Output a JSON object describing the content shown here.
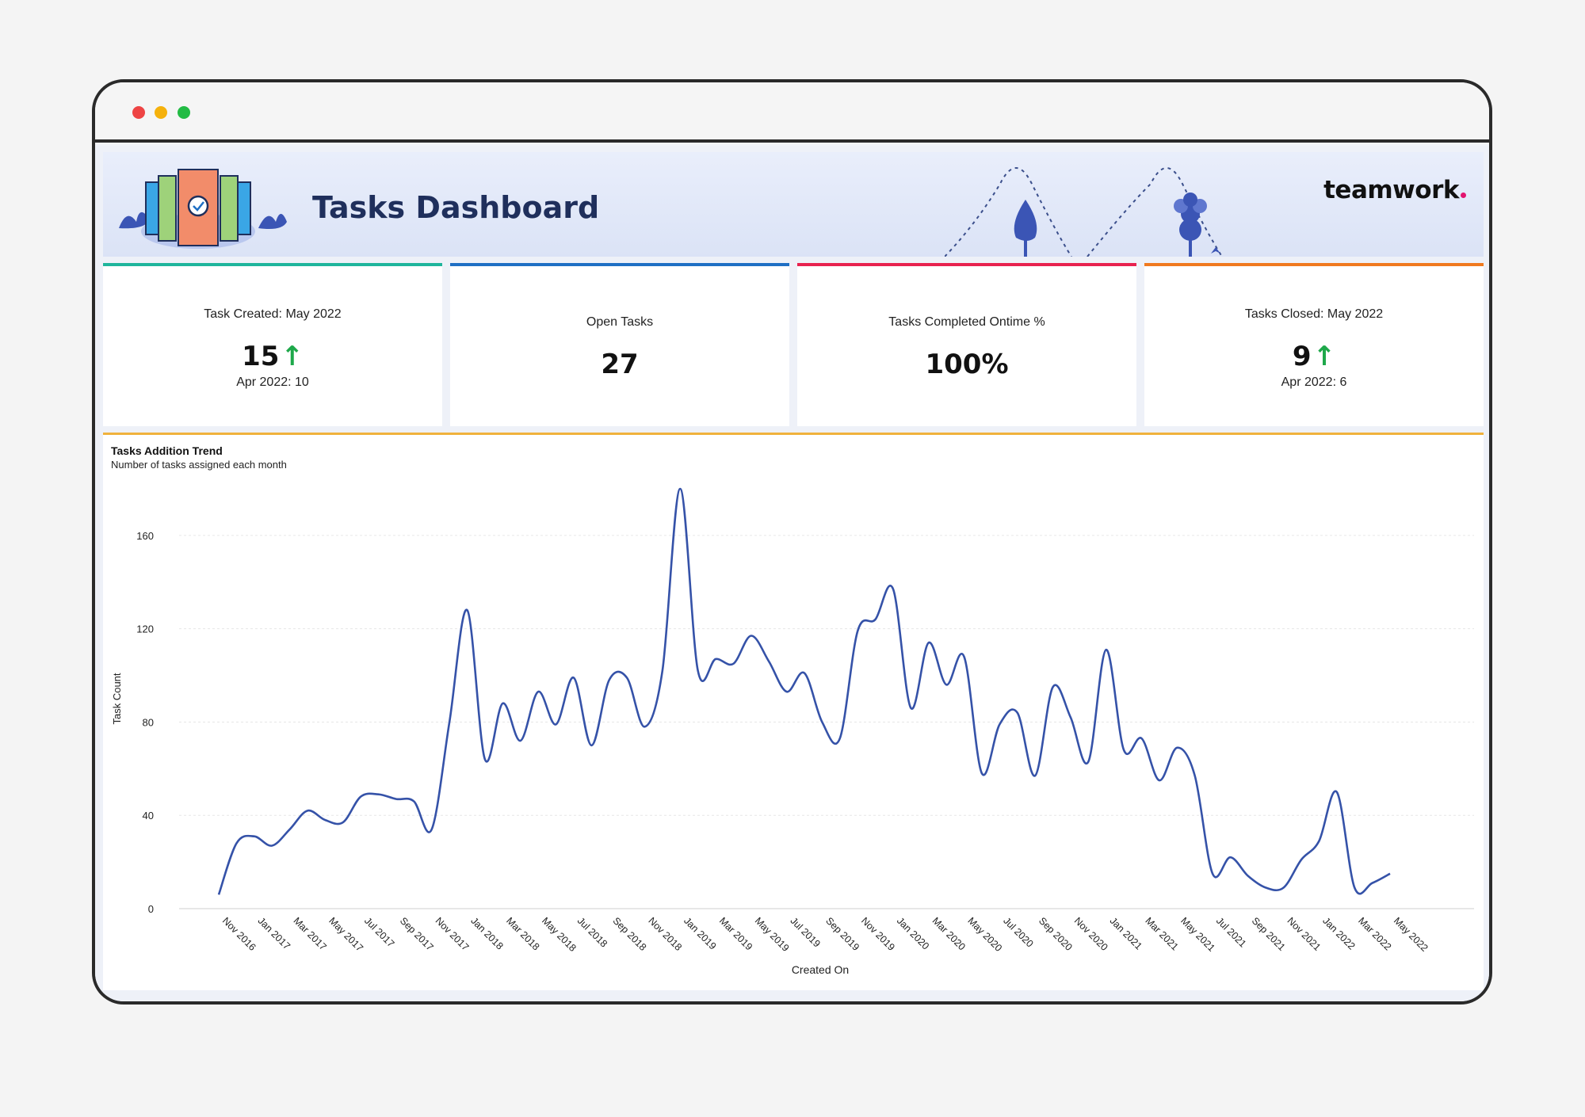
{
  "window": {
    "controls": [
      "close",
      "minimize",
      "maximize"
    ]
  },
  "banner": {
    "title": "Tasks Dashboard",
    "brand": "teamwork",
    "brand_dot_color": "#e2146f"
  },
  "kpis": [
    {
      "label": "Task Created: May 2022",
      "value": "15",
      "trend": "up",
      "sub": "Apr 2022: 10",
      "accent": "#1fb59c"
    },
    {
      "label": "Open Tasks",
      "value": "27",
      "trend": "",
      "sub": "",
      "accent": "#1f6fc4"
    },
    {
      "label": "Tasks Completed Ontime %",
      "value": "100%",
      "trend": "",
      "sub": "",
      "accent": "#e8224f"
    },
    {
      "label": "Tasks Closed: May 2022",
      "value": "9",
      "trend": "up",
      "sub": "Apr 2022: 6",
      "accent": "#f07a1f"
    }
  ],
  "trend_arrow": "↑",
  "chart_panel": {
    "title": "Tasks Addition Trend",
    "subtitle": "Number of tasks assigned each month"
  },
  "chart_data": {
    "type": "line",
    "xlabel": "Created On",
    "ylabel": "Task Count",
    "ylim": [
      0,
      180
    ],
    "yticks": [
      0,
      40,
      80,
      120,
      160
    ],
    "grid": true,
    "color": "#3552a8",
    "x": [
      "Nov 2016",
      "Dec 2016",
      "Jan 2017",
      "Feb 2017",
      "Mar 2017",
      "Apr 2017",
      "May 2017",
      "Jun 2017",
      "Jul 2017",
      "Aug 2017",
      "Sep 2017",
      "Oct 2017",
      "Nov 2017",
      "Dec 2017",
      "Jan 2018",
      "Feb 2018",
      "Mar 2018",
      "Apr 2018",
      "May 2018",
      "Jun 2018",
      "Jul 2018",
      "Aug 2018",
      "Sep 2018",
      "Oct 2018",
      "Nov 2018",
      "Dec 2018",
      "Jan 2019",
      "Feb 2019",
      "Mar 2019",
      "Apr 2019",
      "May 2019",
      "Jun 2019",
      "Jul 2019",
      "Aug 2019",
      "Sep 2019",
      "Oct 2019",
      "Nov 2019",
      "Dec 2019",
      "Jan 2020",
      "Feb 2020",
      "Mar 2020",
      "Apr 2020",
      "May 2020",
      "Jun 2020",
      "Jul 2020",
      "Aug 2020",
      "Sep 2020",
      "Oct 2020",
      "Nov 2020",
      "Dec 2020",
      "Jan 2021",
      "Feb 2021",
      "Mar 2021",
      "Apr 2021",
      "May 2021",
      "Jun 2021",
      "Jul 2021",
      "Aug 2021",
      "Sep 2021",
      "Oct 2021",
      "Nov 2021",
      "Dec 2021",
      "Jan 2022",
      "Feb 2022",
      "Mar 2022",
      "Apr 2022",
      "May 2022"
    ],
    "xtick_labels": [
      "Nov 2016",
      "Jan 2017",
      "Mar 2017",
      "May 2017",
      "Jul 2017",
      "Sep 2017",
      "Nov 2017",
      "Jan 2018",
      "Mar 2018",
      "May 2018",
      "Jul 2018",
      "Sep 2018",
      "Nov 2018",
      "Jan 2019",
      "Mar 2019",
      "May 2019",
      "Jul 2019",
      "Sep 2019",
      "Nov 2019",
      "Jan 2020",
      "Mar 2020",
      "May 2020",
      "Jul 2020",
      "Sep 2020",
      "Nov 2020",
      "Jan 2021",
      "Mar 2021",
      "May 2021",
      "Jul 2021",
      "Sep 2021",
      "Nov 2021",
      "Jan 2022",
      "Mar 2022",
      "May 2022"
    ],
    "values": [
      6,
      28,
      31,
      27,
      34,
      42,
      38,
      37,
      48,
      49,
      47,
      46,
      34,
      80,
      128,
      64,
      88,
      72,
      93,
      79,
      99,
      70,
      98,
      99,
      78,
      102,
      180,
      102,
      107,
      105,
      117,
      106,
      93,
      101,
      80,
      73,
      119,
      124,
      137,
      86,
      114,
      96,
      108,
      58,
      79,
      84,
      57,
      95,
      82,
      63,
      111,
      68,
      73,
      55,
      69,
      57,
      15,
      22,
      14,
      9,
      9,
      21,
      29,
      50,
      9,
      11,
      15
    ]
  }
}
